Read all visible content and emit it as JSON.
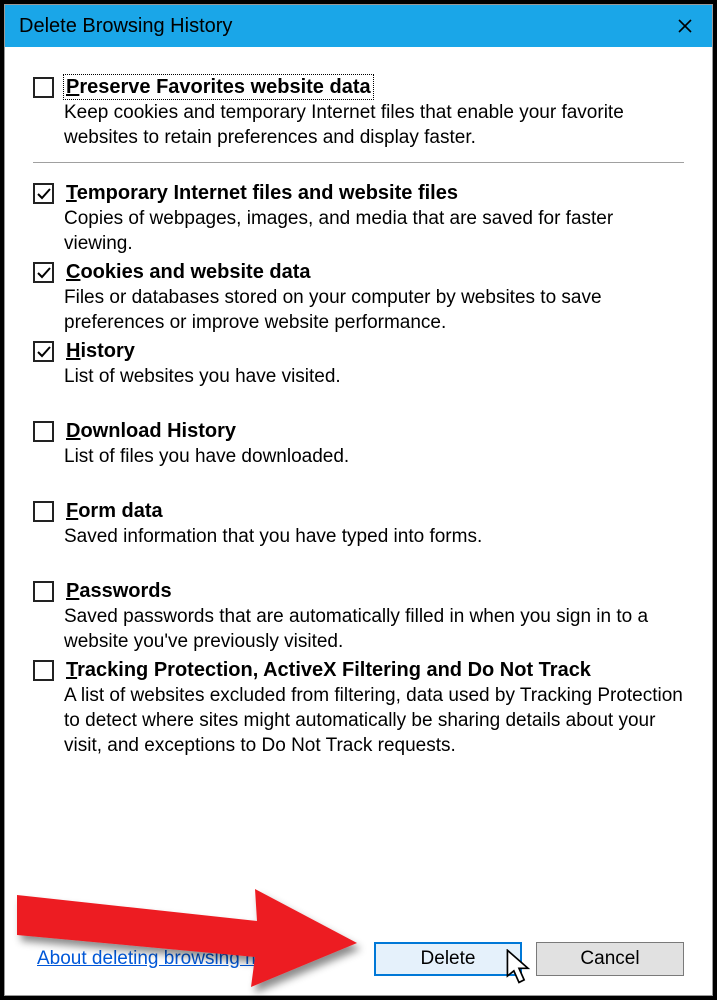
{
  "title": "Delete Browsing History",
  "options": [
    {
      "key": "preserve",
      "label_pre": "P",
      "label_post": "reserve Favorites website data",
      "checked": false,
      "focus": true,
      "desc": "Keep cookies and temporary Internet files that enable your favorite websites to retain preferences and display faster."
    },
    {
      "key": "tempfiles",
      "label_pre": "T",
      "label_post": "emporary Internet files and website files",
      "checked": true,
      "desc": "Copies of webpages, images, and media that are saved for faster viewing."
    },
    {
      "key": "cookies",
      "label_pre": "C",
      "label_post": "ookies and website data",
      "checked": true,
      "desc": "Files or databases stored on your computer by websites to save preferences or improve website performance."
    },
    {
      "key": "history",
      "label_pre": "H",
      "label_post": "istory",
      "checked": true,
      "desc": "List of websites you have visited."
    },
    {
      "key": "download",
      "label_pre": "D",
      "label_post": "ownload History",
      "checked": false,
      "desc": "List of files you have downloaded."
    },
    {
      "key": "form",
      "label_pre": "F",
      "label_post": "orm data",
      "checked": false,
      "desc": "Saved information that you have typed into forms."
    },
    {
      "key": "passwords",
      "label_pre": "P",
      "label_post": "asswords",
      "checked": false,
      "desc": "Saved passwords that are automatically filled in when you sign in to a website you've previously visited."
    },
    {
      "key": "tracking",
      "label_pre": "T",
      "label_post": "racking Protection, ActiveX Filtering and Do Not Track",
      "checked": false,
      "desc": "A list of websites excluded from filtering, data used by Tracking Protection to detect where sites might automatically be sharing details about your visit, and exceptions to Do Not Track requests."
    }
  ],
  "about_link": "About deleting browsing history",
  "buttons": {
    "delete": "Delete",
    "cancel": "Cancel"
  }
}
